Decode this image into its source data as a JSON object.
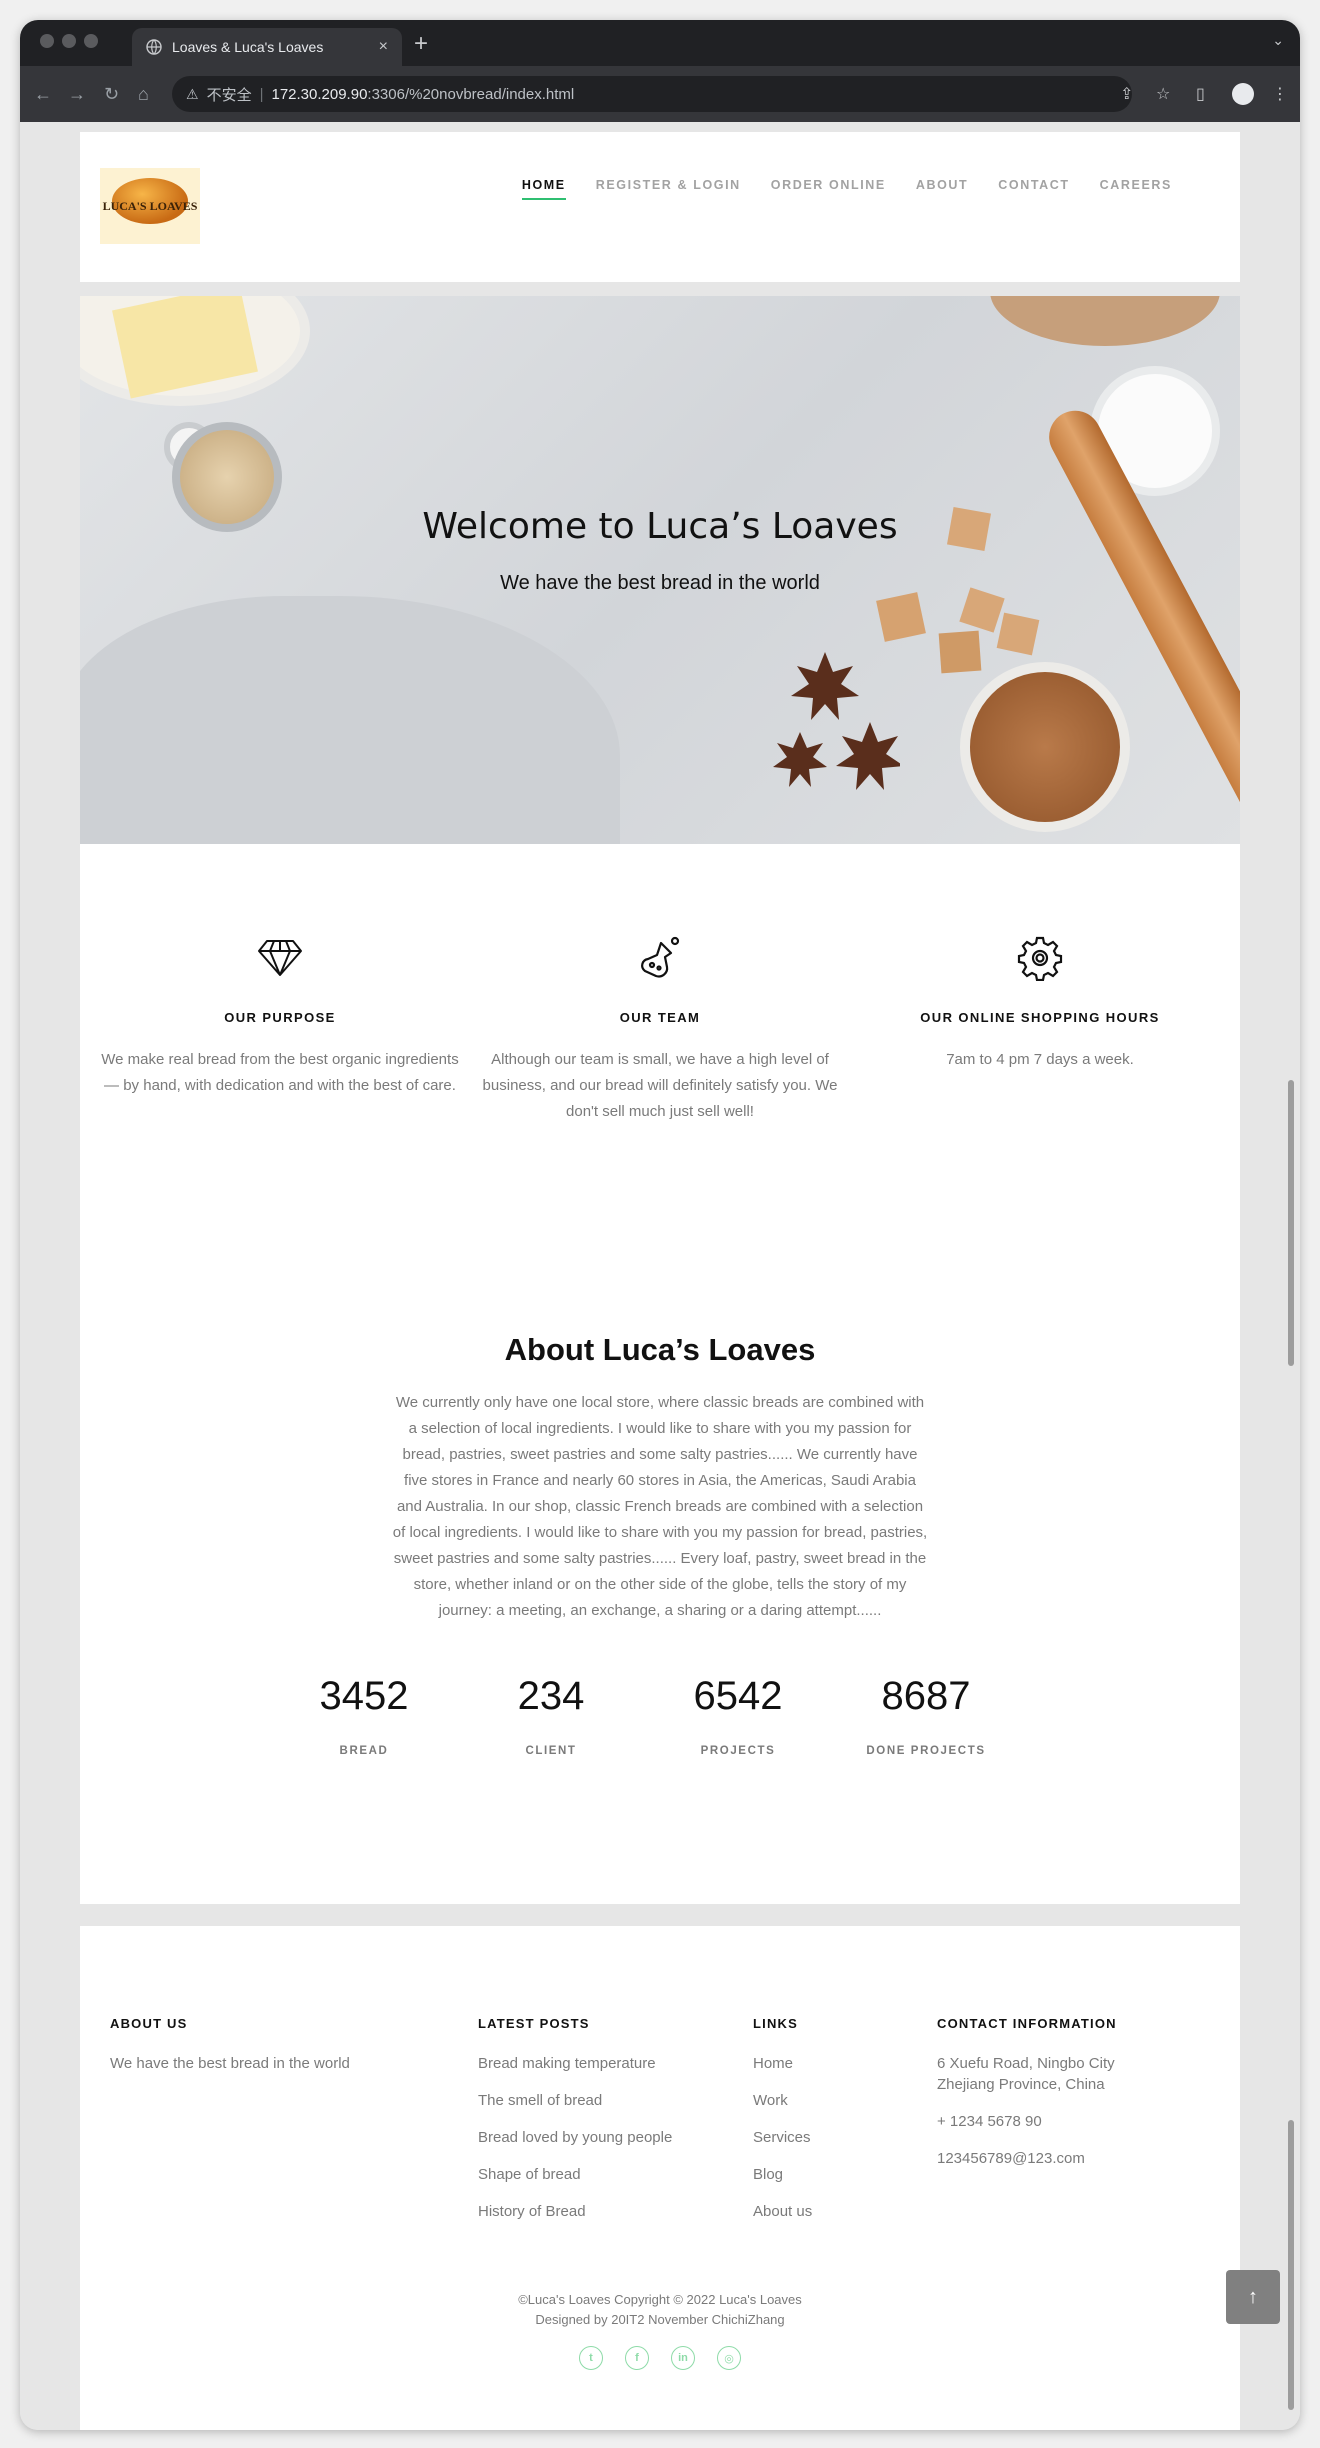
{
  "browser": {
    "tab_title": "Loaves & Luca's Loaves",
    "tab_close": "×",
    "new_tab": "+",
    "tab_menu": "⌄",
    "security_label": "不安全",
    "url_host": "172.30.209.90",
    "url_rest": ":3306/%20novbread/index.html"
  },
  "site": {
    "logo_text": "LUCA'S LOAVES",
    "nav": [
      "HOME",
      "REGISTER & LOGIN",
      "ORDER ONLINE",
      "ABOUT",
      "CONTACT",
      "CAREERS"
    ],
    "active_nav": "HOME"
  },
  "hero": {
    "title": "Welcome to Luca’s Loaves",
    "subtitle": "We have the best bread in the world"
  },
  "features": [
    {
      "icon": "diamond-icon",
      "title": "OUR PURPOSE",
      "text": "We make real bread from the best organic ingredients — by hand, with dedication and with the best of care."
    },
    {
      "icon": "flask-icon",
      "title": "OUR TEAM",
      "text": "Although our team is small, we have a high level of business, and our bread will definitely satisfy you. We don't sell much just sell well!"
    },
    {
      "icon": "gear-icon",
      "title": "OUR ONLINE SHOPPING HOURS",
      "text": "7am to 4 pm 7 days a week."
    }
  ],
  "about": {
    "title": "About Luca’s Loaves",
    "text": "We currently only have one local store, where classic breads are combined with a selection of local ingredients. I would like to share with you my passion for bread, pastries, sweet pastries and some salty pastries...... We currently have five stores in France and nearly 60 stores in Asia, the Americas, Saudi Arabia and Australia. In our shop, classic French breads are combined with a selection of local ingredients. I would like to share with you my passion for bread, pastries, sweet pastries and some salty pastries...... Every loaf, pastry, sweet bread in the store, whether inland or on the other side of the globe, tells the story of my journey: a meeting, an exchange, a sharing or a daring attempt......"
  },
  "stats": [
    {
      "value": "3452",
      "label": "BREAD"
    },
    {
      "value": "234",
      "label": "CLIENT"
    },
    {
      "value": "6542",
      "label": "PROJECTS"
    },
    {
      "value": "8687",
      "label": "DONE PROJECTS"
    }
  ],
  "footer": {
    "about_us": {
      "heading": "ABOUT US",
      "text": "We have the best bread in the world"
    },
    "latest_posts": {
      "heading": "LATEST POSTS",
      "items": [
        "Bread making temperature",
        "The smell of bread",
        "Bread loved by young people",
        "Shape of bread",
        "History of Bread"
      ]
    },
    "links": {
      "heading": "LINKS",
      "items": [
        "Home",
        "Work",
        "Services",
        "Blog",
        "About us"
      ]
    },
    "contact": {
      "heading": "CONTACT INFORMATION",
      "address": "6 Xuefu Road, Ningbo City Zhejiang Province, China",
      "phone": "+ 1234 5678 90",
      "email": "123456789@123.com"
    },
    "copyright_line1": "©Luca's Loaves Copyright © 2022 Luca's Loaves",
    "copyright_line2": "Designed by 20IT2 November ChichiZhang",
    "socials": [
      "twitter-icon",
      "facebook-icon",
      "linkedin-icon",
      "dribbble-icon"
    ],
    "back_to_top": "↑"
  },
  "colors": {
    "accent": "#2fbf71",
    "social": "#8edba8",
    "text_muted": "#7a7a7a"
  }
}
